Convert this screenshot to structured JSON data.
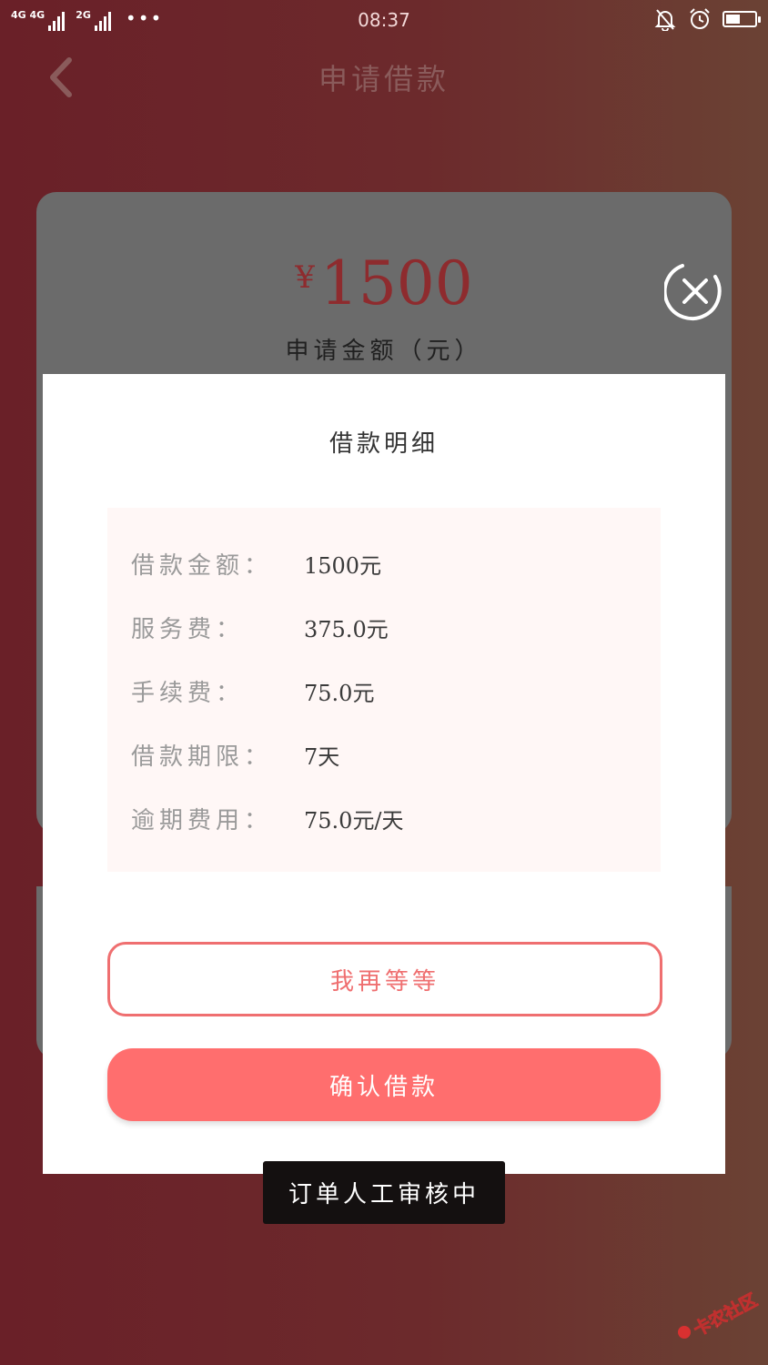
{
  "status_bar": {
    "network_1": "4G 4G",
    "network_2": "2G",
    "more": "•••",
    "time": "08:37",
    "battery_level": 0.5
  },
  "header": {
    "title": "申请借款"
  },
  "card": {
    "currency": "¥",
    "amount": "1500",
    "amount_label": "申请金额（元）"
  },
  "modal": {
    "title": "借款明细",
    "rows": [
      {
        "label": "借款金额：",
        "value": "1500元"
      },
      {
        "label": "服务费：",
        "value": "375.0元"
      },
      {
        "label": "手续费：",
        "value": "75.0元"
      },
      {
        "label": "借款期限：",
        "value": "7天"
      },
      {
        "label": "逾期费用：",
        "value": "75.0元/天"
      }
    ],
    "wait_button": "我再等等",
    "confirm_button": "确认借款"
  },
  "toast": "订单人工审核中",
  "watermark_text": "卡农社区",
  "colors": {
    "accent": "#ff6e6e",
    "accent_border": "#ef6f70",
    "amount_red": "#8e2b2e",
    "background": "#6a2028",
    "overlay_card": "#6b6b6b"
  }
}
